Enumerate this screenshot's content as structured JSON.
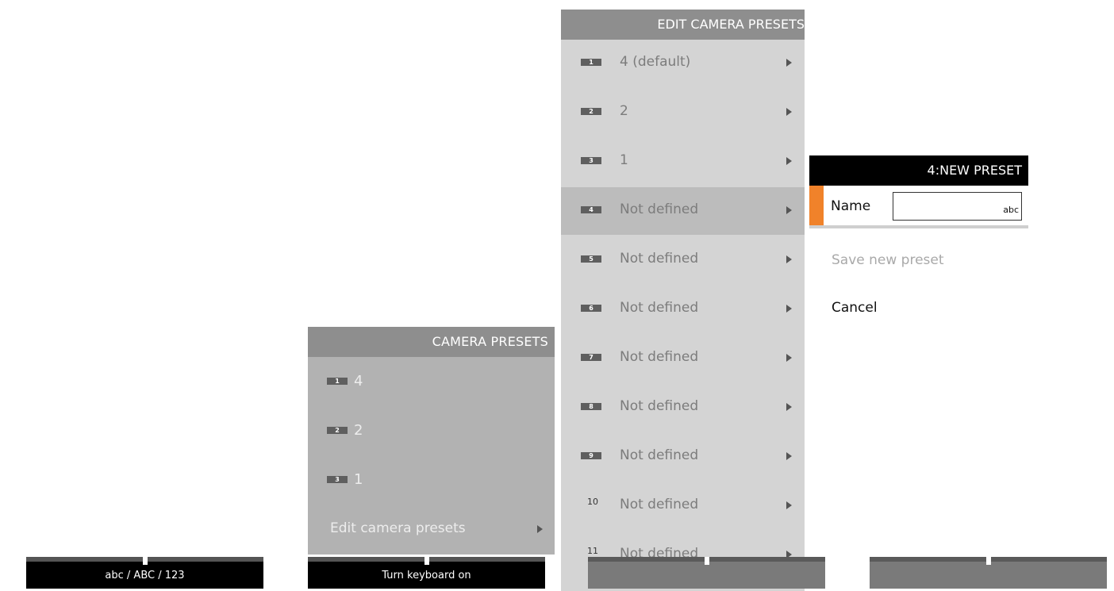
{
  "camera_presets": {
    "title": "CAMERA PRESETS",
    "items": [
      {
        "badge": "1",
        "label": "4"
      },
      {
        "badge": "2",
        "label": "2"
      },
      {
        "badge": "3",
        "label": "1"
      }
    ],
    "edit_label": "Edit camera presets"
  },
  "edit_camera_presets": {
    "title": "EDIT CAMERA PRESETS",
    "items": [
      {
        "badge": "1",
        "label": "4 (default)"
      },
      {
        "badge": "2",
        "label": "2"
      },
      {
        "badge": "3",
        "label": "1"
      },
      {
        "badge": "4",
        "label": "Not defined",
        "selected": true
      },
      {
        "badge": "5",
        "label": "Not defined"
      },
      {
        "badge": "6",
        "label": "Not defined"
      },
      {
        "badge": "7",
        "label": "Not defined"
      },
      {
        "badge": "8",
        "label": "Not defined"
      },
      {
        "badge": "9",
        "label": "Not defined"
      },
      {
        "badge": "10",
        "label": "Not defined"
      },
      {
        "badge": "11",
        "label": "Not defined"
      }
    ]
  },
  "new_preset": {
    "title": "4:NEW PRESET",
    "name_label": "Name",
    "name_value": "",
    "input_mode": "abc",
    "save_label": "Save new preset",
    "cancel_label": "Cancel",
    "accent_color": "#f0822a"
  },
  "softkeys": [
    {
      "label": "abc / ABC / 123"
    },
    {
      "label": "Turn keyboard on"
    },
    {
      "label": ""
    },
    {
      "label": ""
    }
  ]
}
